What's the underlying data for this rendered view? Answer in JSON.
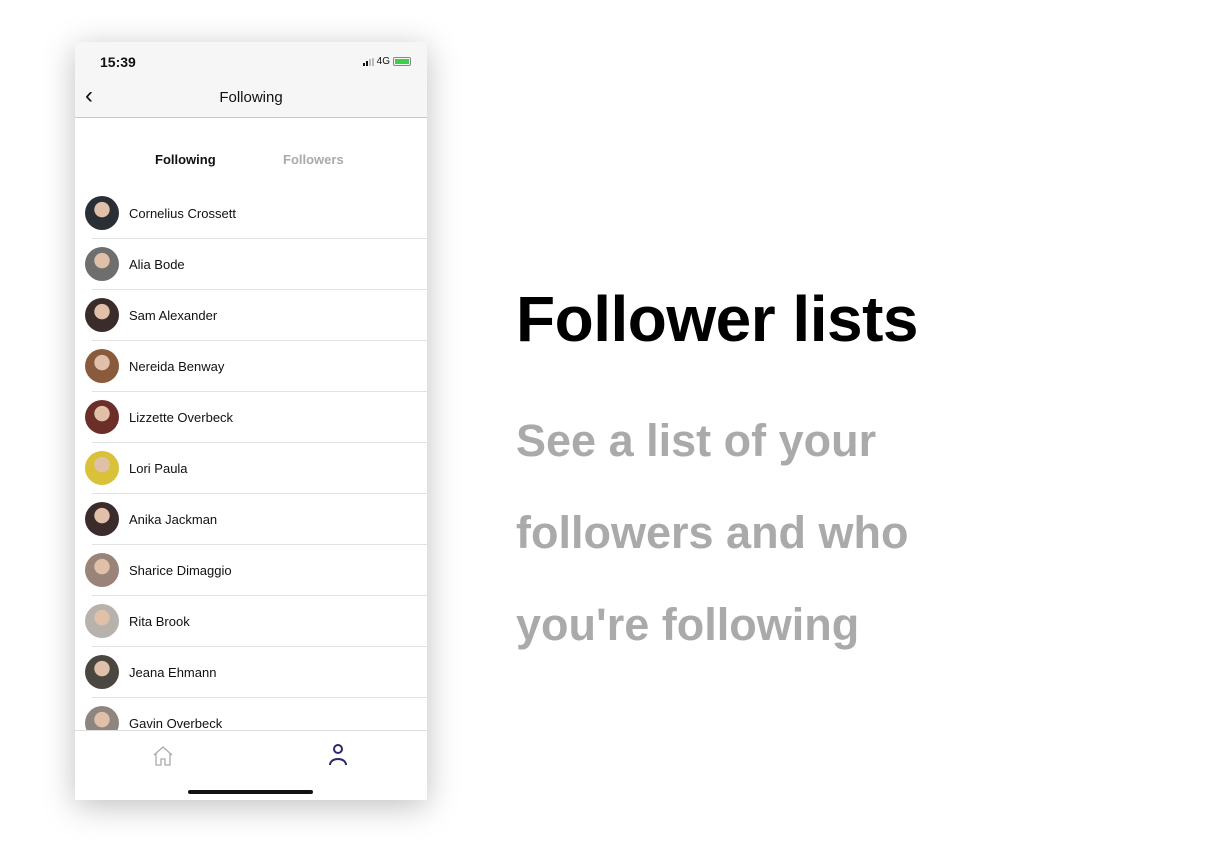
{
  "status_bar": {
    "time": "15:39",
    "network": "4G"
  },
  "nav": {
    "title": "Following",
    "back_icon": "chevron-left-icon"
  },
  "tabs": [
    {
      "label": "Following",
      "active": true
    },
    {
      "label": "Followers",
      "active": false
    }
  ],
  "people": [
    {
      "name": "Cornelius Crossett",
      "color": "#2a2f35"
    },
    {
      "name": "Alia Bode",
      "color": "#6e6e6e"
    },
    {
      "name": "Sam Alexander",
      "color": "#3a2c2a"
    },
    {
      "name": "Nereida Benway",
      "color": "#8a5a3c"
    },
    {
      "name": "Lizzette Overbeck",
      "color": "#6b2e28"
    },
    {
      "name": "Lori Paula",
      "color": "#d9c23a"
    },
    {
      "name": "Anika Jackman",
      "color": "#3b2b2b"
    },
    {
      "name": "Sharice Dimaggio",
      "color": "#9a8378"
    },
    {
      "name": "Rita Brook",
      "color": "#b8b2ac"
    },
    {
      "name": "Jeana Ehmann",
      "color": "#4a4640"
    },
    {
      "name": "Gavin Overbeck",
      "color": "#8f8580"
    }
  ],
  "tabbar": {
    "home_icon": "home-icon",
    "profile_icon": "person-icon",
    "accent": "#2b2a6b"
  },
  "promo": {
    "title": "Follower lists",
    "subtitle_lines": [
      "See a list of your",
      "followers and who",
      "you're following"
    ]
  }
}
